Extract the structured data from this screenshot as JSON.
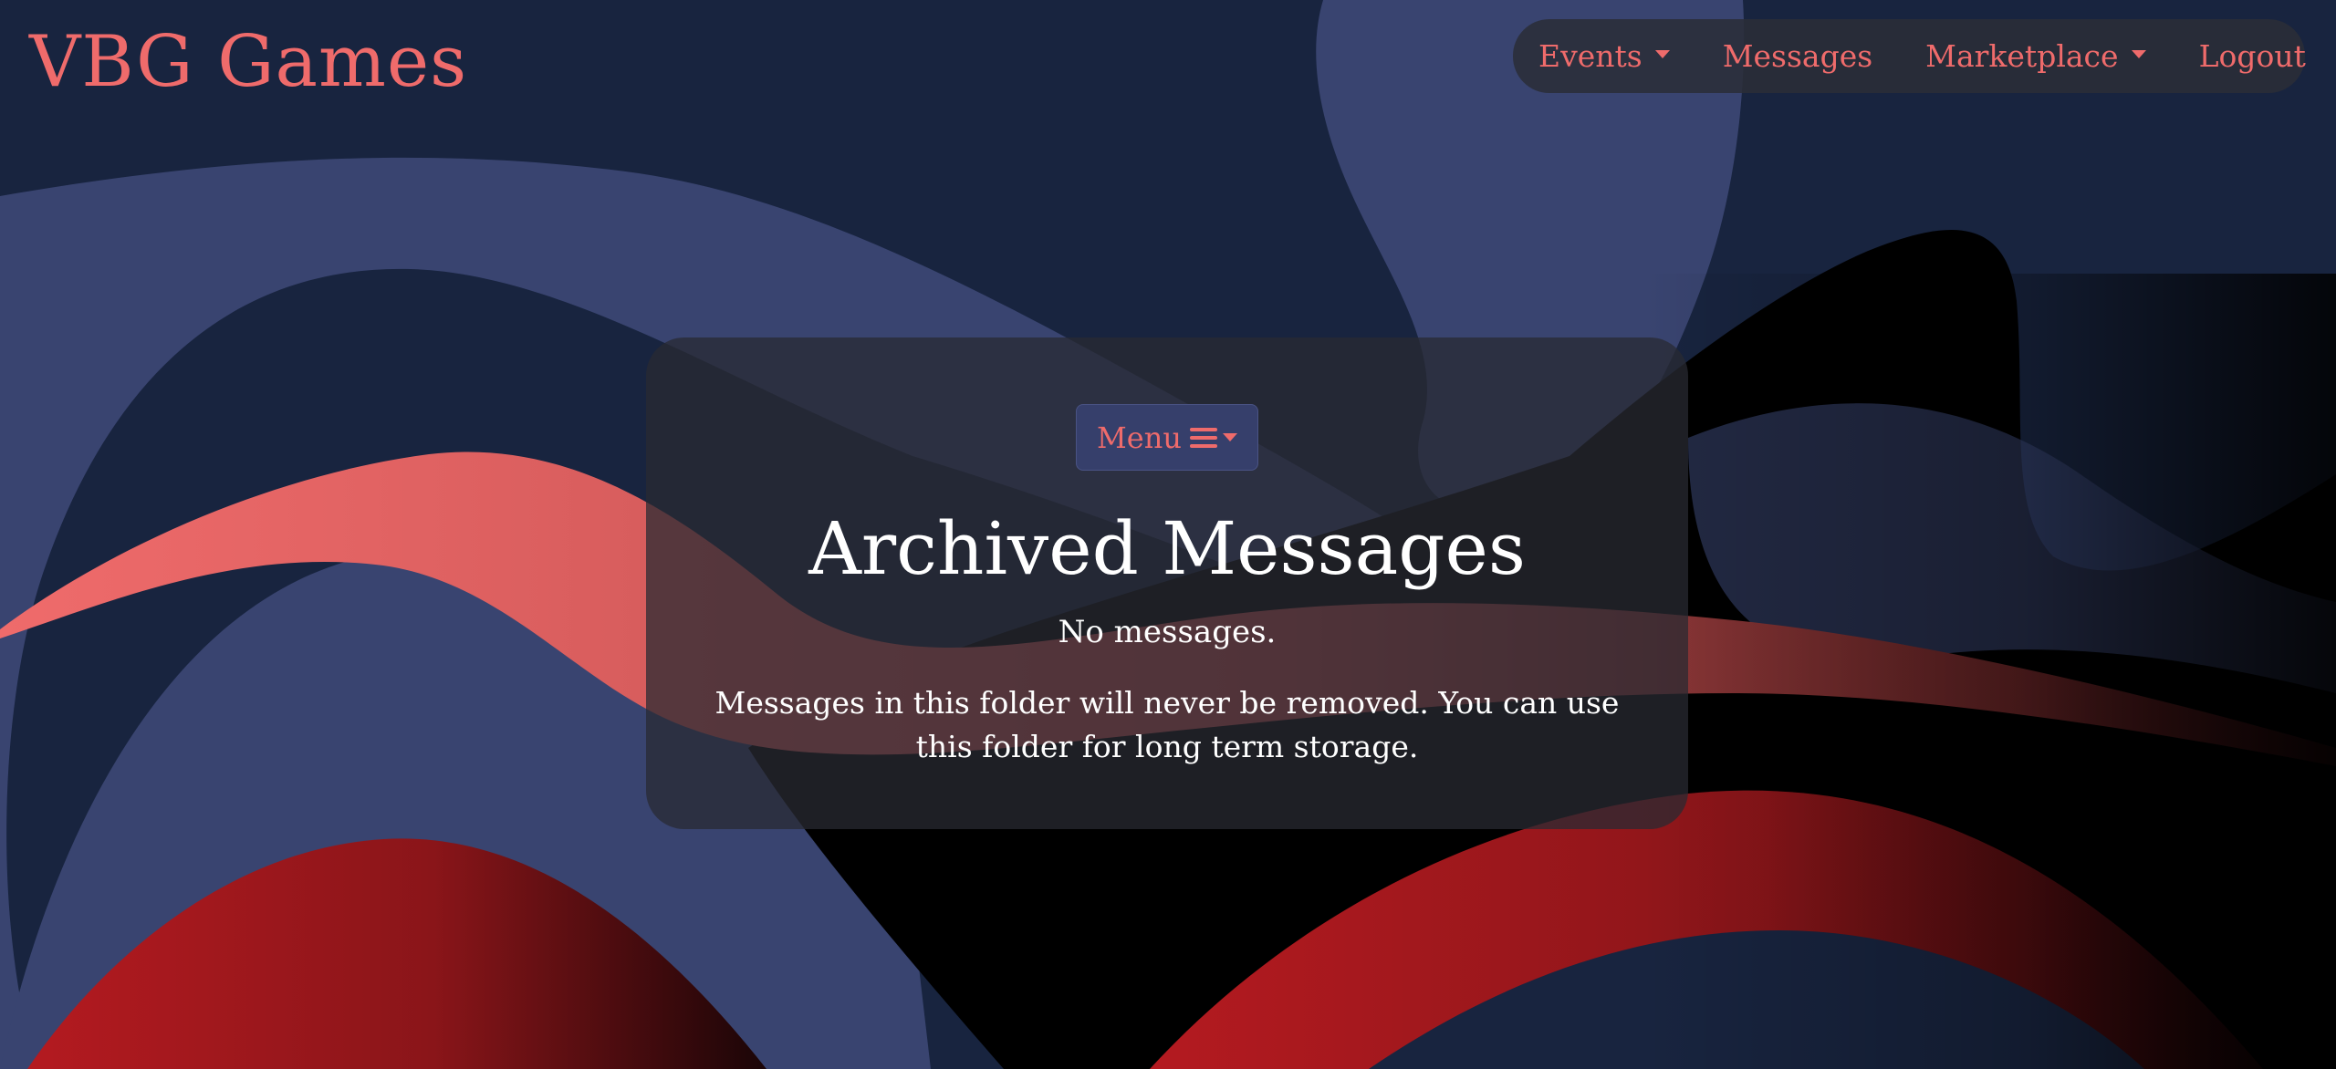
{
  "brand": {
    "name": "VBG Games"
  },
  "nav": {
    "items": [
      {
        "label": "Events",
        "dropdown": true
      },
      {
        "label": "Messages",
        "dropdown": false
      },
      {
        "label": "Marketplace",
        "dropdown": true
      },
      {
        "label": "Logout",
        "dropdown": false
      }
    ]
  },
  "card": {
    "menu_label": "Menu",
    "menu_icon": "hamburger-icon",
    "title": "Archived Messages",
    "empty_text": "No messages.",
    "info_text": "Messages in this folder will never be removed. You can use this folder for long term storage."
  },
  "colors": {
    "background": "#18243f",
    "accent": "#ef6b6b",
    "wave_blue": "#394470",
    "wave_red": "#b41a20",
    "menu_button": "#363f6b"
  }
}
